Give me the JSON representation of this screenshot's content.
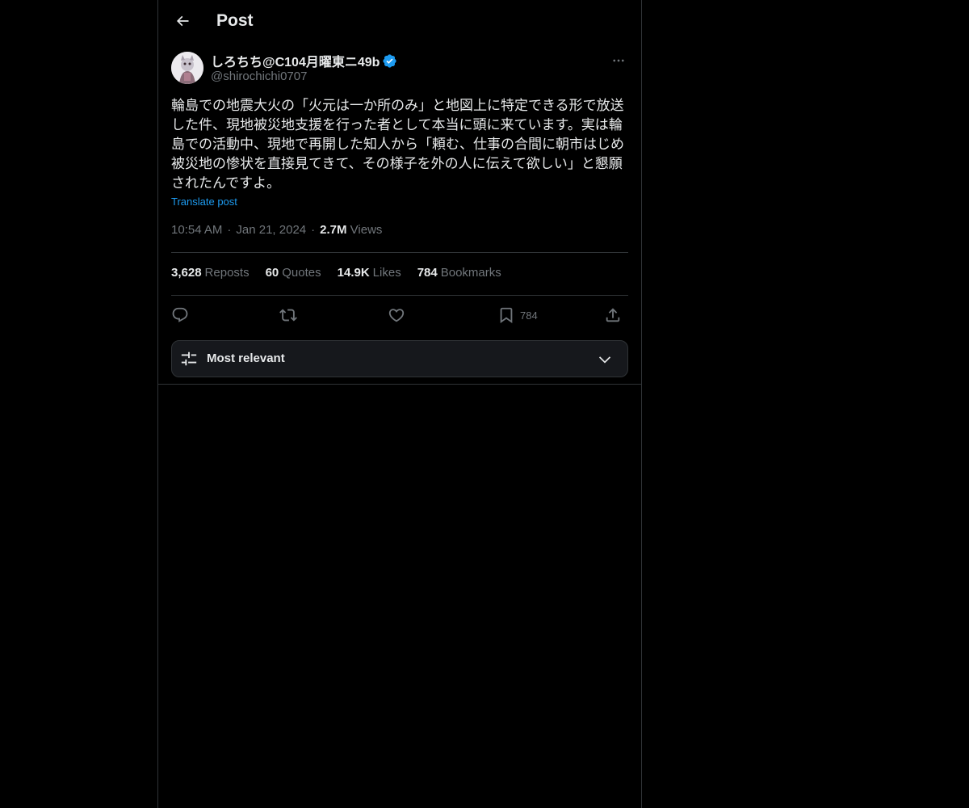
{
  "header": {
    "title": "Post",
    "back_icon": "arrow-left-icon"
  },
  "author": {
    "display_name": "しろちち@C104月曜東ニ49b",
    "handle": "@shirochichi0707",
    "verified_icon": "verified-badge-icon",
    "more_icon": "more-horizontal-icon"
  },
  "post": {
    "text": "輪島での地震大火の「火元は一か所のみ」と地図上に特定できる形で放送した件、現地被災地支援を行った者として本当に頭に来ています。実は輪島での活動中、現地で再開した知人から「頼む、仕事の合間に朝市はじめ被災地の惨状を直接見てきて、その様子を外の人に伝えて欲しい」と懇願されたんですよ。",
    "translate_label": "Translate post",
    "time": "10:54 AM",
    "date": "Jan 21, 2024",
    "views_count": "2.7M",
    "views_label": "Views",
    "separator": "·"
  },
  "stats": [
    {
      "num": "3,628",
      "label": "Reposts"
    },
    {
      "num": "60",
      "label": "Quotes"
    },
    {
      "num": "14.9K",
      "label": "Likes"
    },
    {
      "num": "784",
      "label": "Bookmarks"
    }
  ],
  "actions": {
    "reply_icon": "reply-icon",
    "repost_icon": "repost-icon",
    "like_icon": "heart-icon",
    "bookmark_icon": "bookmark-icon",
    "bookmark_count": "784",
    "share_icon": "share-icon"
  },
  "sort": {
    "label": "Most relevant",
    "icon": "sliders-icon",
    "chevron": "chevron-down-icon"
  },
  "colors": {
    "background": "#000000",
    "text": "#e7e9ea",
    "muted": "#71767b",
    "accent": "#1d9bf0",
    "border": "#2f3336"
  }
}
